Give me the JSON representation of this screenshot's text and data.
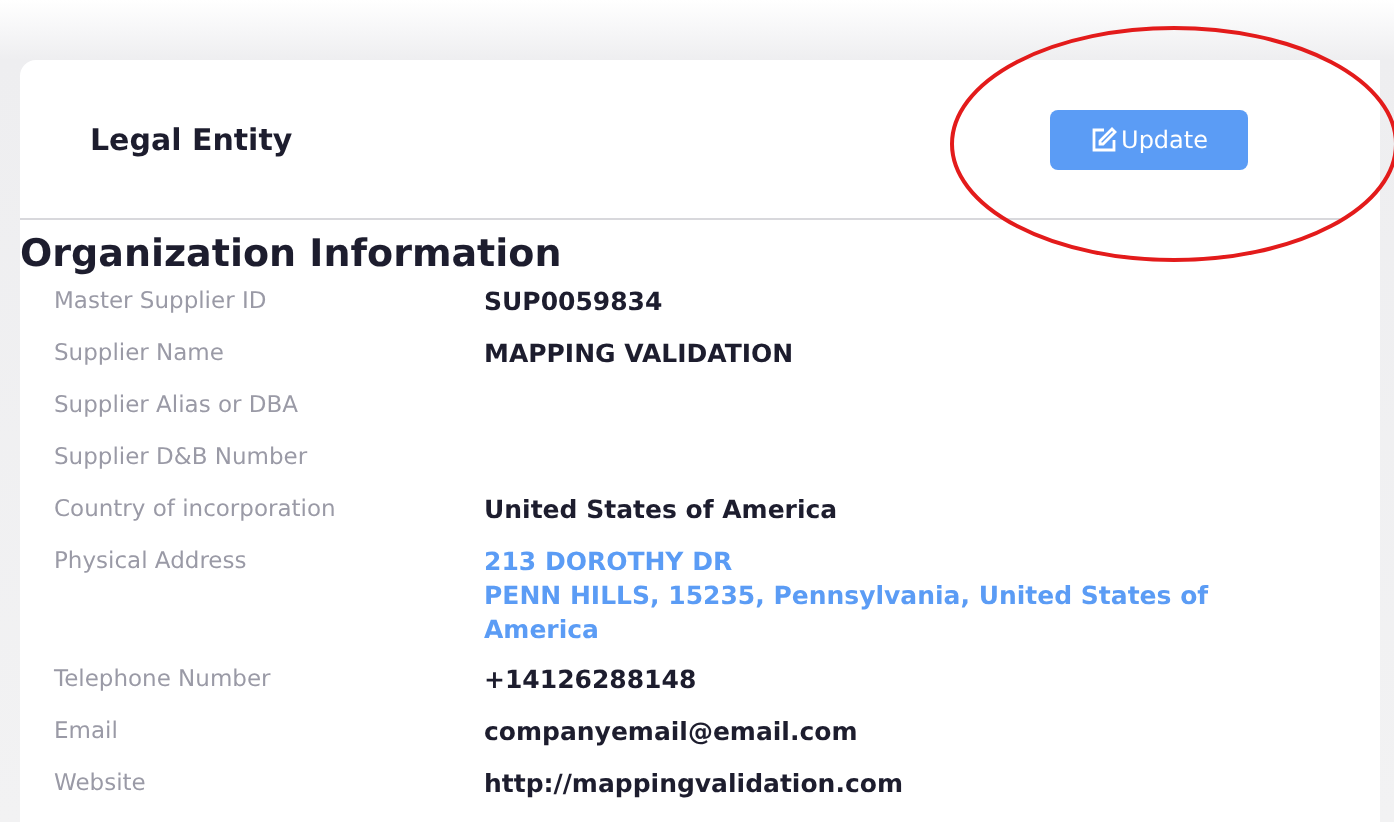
{
  "header": {
    "title": "Legal Entity",
    "button": {
      "label": "Update"
    }
  },
  "section": {
    "title": "Organization Information",
    "fields": [
      {
        "kind": "text",
        "label": "Master Supplier ID",
        "value": "SUP0059834"
      },
      {
        "kind": "text",
        "label": "Supplier Name",
        "value": "MAPPING VALIDATION"
      },
      {
        "kind": "empty",
        "label": "Supplier Alias or DBA"
      },
      {
        "kind": "empty",
        "label": "Supplier D&B Number"
      },
      {
        "kind": "text",
        "label": "Country of incorporation",
        "value": "United States of America"
      },
      {
        "kind": "address",
        "label": "Physical Address",
        "lines": [
          "213 DOROTHY DR",
          "PENN HILLS, 15235, Pennsylvania, United States of America"
        ]
      },
      {
        "kind": "text",
        "label": "Telephone Number",
        "value": "+14126288148"
      },
      {
        "kind": "text",
        "label": "Email",
        "value": "companyemail@email.com"
      },
      {
        "kind": "text",
        "label": "Website",
        "value": "http://mappingvalidation.com"
      }
    ]
  }
}
